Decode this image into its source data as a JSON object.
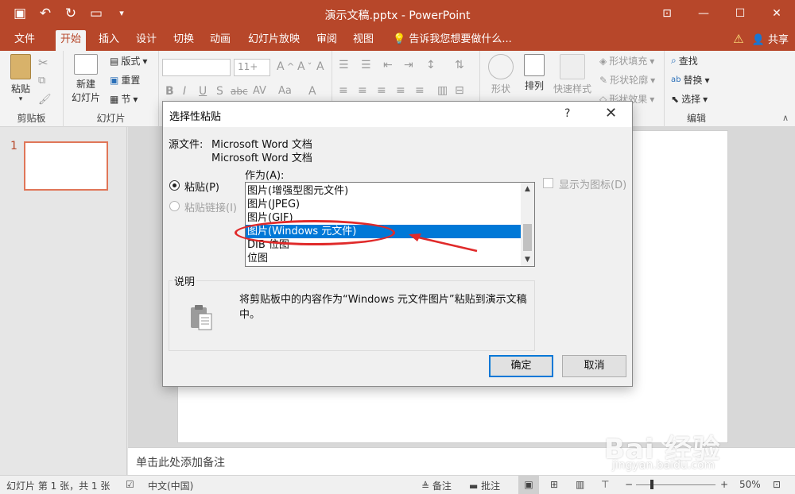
{
  "window": {
    "title": "演示文稿.pptx - PowerPoint",
    "qat": [
      "save-icon",
      "undo-icon",
      "redo-icon",
      "present-icon",
      "customize-icon"
    ]
  },
  "tabs": [
    "文件",
    "开始",
    "插入",
    "设计",
    "切换",
    "动画",
    "幻灯片放映",
    "审阅",
    "视图"
  ],
  "active_tab": "开始",
  "tellme": "告诉我您想要做什么...",
  "share": "共享",
  "ribbon": {
    "clipboard": {
      "paste": "粘贴",
      "group": "剪贴板"
    },
    "slides": {
      "new_slide_line1": "新建",
      "new_slide_line2": "幻灯片",
      "layout": "版式",
      "reset": "重置",
      "section": "节",
      "group": "幻灯片"
    },
    "font": {
      "size": "11+"
    },
    "drawing": {
      "shape": "形状",
      "arrange": "排列",
      "quick_styles": "快速样式",
      "fill": "形状填充",
      "outline": "形状轮廓",
      "effects": "形状效果"
    },
    "editing": {
      "find": "查找",
      "replace": "替换",
      "select": "选择",
      "group": "编辑"
    }
  },
  "slides_panel": {
    "slide_number": "1"
  },
  "notes_placeholder": "单击此处添加备注",
  "statusbar": {
    "slide_info": "幻灯片 第 1 张，共 1 张",
    "language": "中文(中国)",
    "notes": "备注",
    "comments": "批注",
    "zoom": "50%"
  },
  "dialog": {
    "title": "选择性粘贴",
    "help": "?",
    "close": "✕",
    "source_label": "源文件:",
    "source_line1": "Microsoft Word 文档",
    "source_line2": "Microsoft Word 文档",
    "as_label": "作为(A):",
    "paste_option": "粘贴(P)",
    "paste_link_option": "粘贴链接(I)",
    "formats": [
      "图片(增强型图元文件)",
      "图片(JPEG)",
      "图片(GIF)",
      "图片(Windows 元文件)",
      "DIB 位图",
      "位图"
    ],
    "selected_format": "图片(Windows 元文件)",
    "display_as_icon": "显示为图标(D)",
    "result_label": "说明",
    "result_text_line1": "将剪贴板中的内容作为“Windows 元文件图片”粘贴到演示文稿",
    "result_text_line2": "中。",
    "ok": "确定",
    "cancel": "取消"
  },
  "watermark": {
    "brand": "Bai  经验",
    "url": "jingyan.baidu.com"
  },
  "colors": {
    "accent": "#b7472a",
    "selection": "#0078d7",
    "annotation": "#e02a2a"
  }
}
